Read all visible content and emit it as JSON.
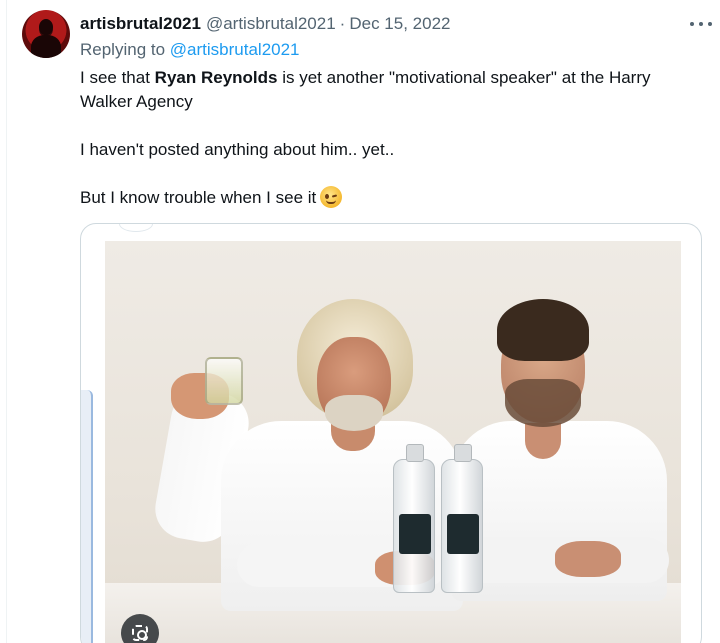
{
  "tweet": {
    "display_name": "artisbrutal2021",
    "handle": "@artisbrutal2021",
    "separator": "·",
    "date": "Dec 15, 2022",
    "more_icon": "more-horizontal-icon",
    "reply_prefix": "Replying to",
    "reply_mention": "@artisbrutal2021",
    "body": {
      "line1_pre": "I see that ",
      "line1_bold": "Ryan Reynolds",
      "line1_post": " is yet another \"motivational speaker\" at the Harry Walker Agency",
      "line2": "I haven't posted anything about him.. yet..",
      "line3": "But I know trouble when I see it",
      "emoji": "winking-face-emoji"
    },
    "media": {
      "type": "photo",
      "lens_icon": "visual-search-icon"
    }
  },
  "colors": {
    "text_primary": "#0f1419",
    "text_secondary": "#536471",
    "link": "#1d9bf0",
    "border": "#cfd9de"
  }
}
